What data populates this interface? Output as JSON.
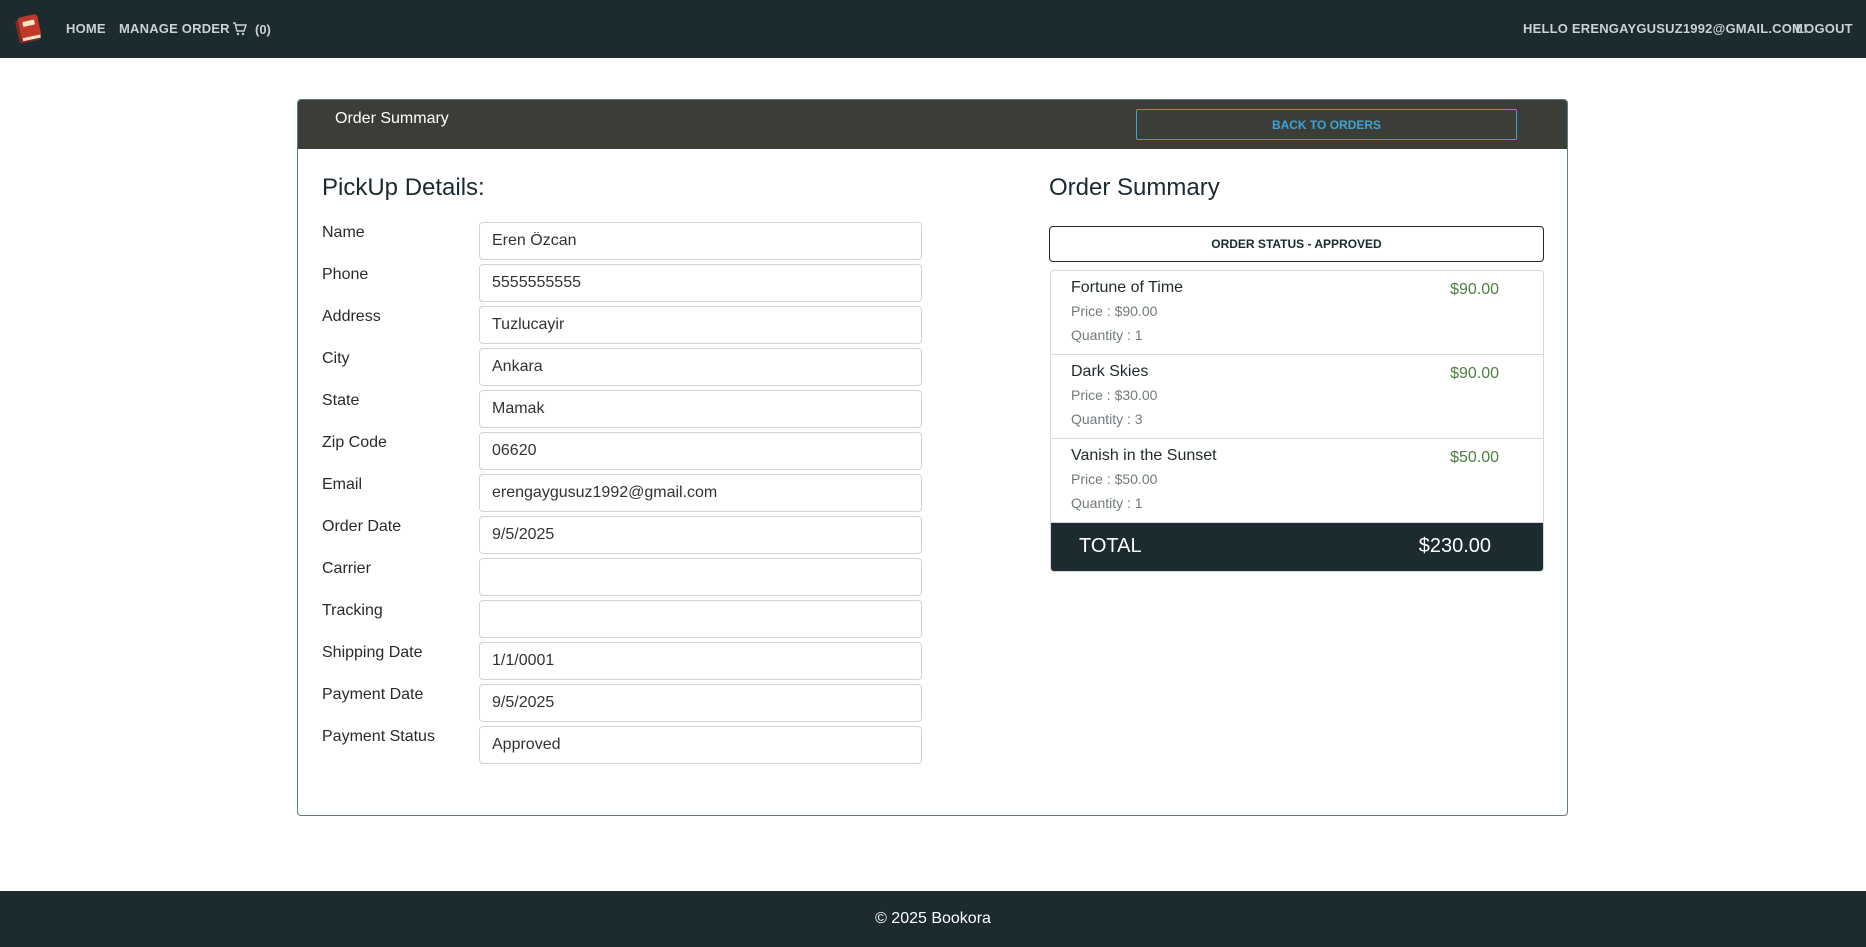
{
  "nav": {
    "home": "HOME",
    "manage_order": "MANAGE ORDER",
    "cart_count": "(0)",
    "greeting": "HELLO ERENGAYGUSUZ1992@GMAIL.COM!",
    "logout": "LOGOUT"
  },
  "card": {
    "header_title": "Order Summary",
    "back_button": "BACK TO ORDERS"
  },
  "pickup": {
    "heading": "PickUp Details:",
    "fields": [
      {
        "label": "Name",
        "value": "Eren Özcan"
      },
      {
        "label": "Phone",
        "value": "5555555555"
      },
      {
        "label": "Address",
        "value": "Tuzlucayir"
      },
      {
        "label": "City",
        "value": "Ankara"
      },
      {
        "label": "State",
        "value": "Mamak"
      },
      {
        "label": "Zip Code",
        "value": "06620"
      },
      {
        "label": "Email",
        "value": "erengaygusuz1992@gmail.com"
      },
      {
        "label": "Order Date",
        "value": "9/5/2025"
      },
      {
        "label": "Carrier",
        "value": ""
      },
      {
        "label": "Tracking",
        "value": ""
      },
      {
        "label": "Shipping Date",
        "value": "1/1/0001"
      },
      {
        "label": "Payment Date",
        "value": "9/5/2025"
      },
      {
        "label": "Payment Status",
        "value": "Approved"
      }
    ]
  },
  "summary": {
    "heading": "Order Summary",
    "status": "ORDER STATUS - APPROVED",
    "items": [
      {
        "title": "Fortune of Time",
        "price": "Price : $90.00",
        "quantity": "Quantity : 1",
        "total": "$90.00"
      },
      {
        "title": "Dark Skies",
        "price": "Price : $30.00",
        "quantity": "Quantity : 3",
        "total": "$90.00"
      },
      {
        "title": "Vanish in the Sunset",
        "price": "Price : $50.00",
        "quantity": "Quantity : 1",
        "total": "$50.00"
      }
    ],
    "total_label": "TOTAL",
    "total_value": "$230.00"
  },
  "footer": {
    "text": "© 2025 Bookora"
  },
  "colors": {
    "nav_bg": "#1b2b30",
    "card_header_bg": "#3d3d38",
    "accent": "#3aa3d8",
    "item_total": "#4e8040"
  },
  "icons": {
    "logo": "book-logo-icon",
    "cart": "cart-icon"
  }
}
